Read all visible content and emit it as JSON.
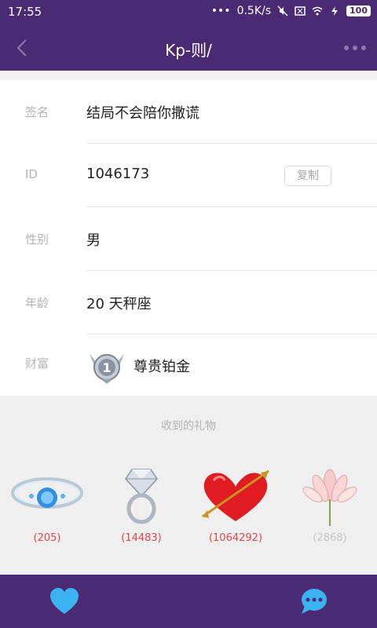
{
  "status_bar": {
    "time": "17:55",
    "network_speed": "0.5K/s",
    "battery": "100"
  },
  "header": {
    "title": "Kp-则/",
    "back_icon": "chevron-left-icon",
    "more_icon": "more-dots-icon"
  },
  "profile": {
    "signature": {
      "label": "签名",
      "value": "结局不会陪你撒谎"
    },
    "id": {
      "label": "ID",
      "value": "1046173",
      "copy_label": "复制"
    },
    "gender": {
      "label": "性别",
      "value": "男"
    },
    "age": {
      "label": "年龄",
      "value": "20 天秤座"
    },
    "wealth": {
      "label": "财富",
      "value": "尊贵铂金",
      "badge_number": "1"
    }
  },
  "gifts": {
    "title": "收到的礼物",
    "items": [
      {
        "icon": "bracelet-icon",
        "count": "(205)",
        "color": "#e0454a"
      },
      {
        "icon": "diamond-ring-icon",
        "count": "(14483)",
        "color": "#e0454a"
      },
      {
        "icon": "heart-arrow-icon",
        "count": "(1064292)",
        "color": "#e0454a"
      },
      {
        "icon": "lotus-icon",
        "count": "(2868)",
        "color": "#c4c4c4"
      }
    ]
  },
  "bottom_bar": {
    "like_icon": "heart-icon",
    "chat_icon": "chat-bubble-icon"
  },
  "colors": {
    "primary": "#4a2a73",
    "accent": "#3ab3f0",
    "count_red": "#e0454a"
  }
}
